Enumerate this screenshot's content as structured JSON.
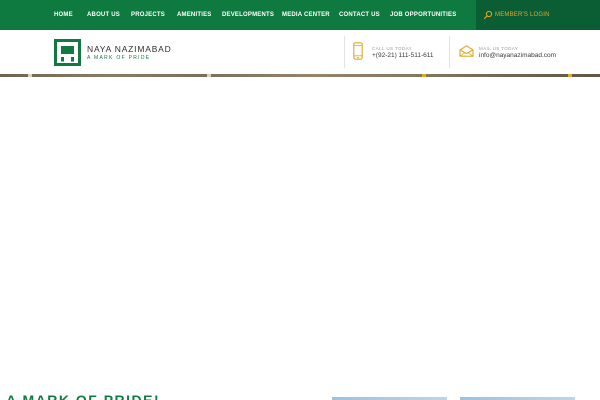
{
  "nav": {
    "items": [
      {
        "label": "HOME"
      },
      {
        "label": "ABOUT US"
      },
      {
        "label": "PROJECTS"
      },
      {
        "label": "AMENITIES"
      },
      {
        "label": "DEVELOPMENTS"
      },
      {
        "label": "MEDIA CENTER"
      },
      {
        "label": "CONTACT US"
      },
      {
        "label": "JOB OPPORTUNITIES"
      }
    ],
    "members_login": "MEMBER'S LOGIN",
    "members_icon": "search-icon"
  },
  "brand": {
    "name": "NAYA NAZIMABAD",
    "tagline": "A MARK OF PRIDE",
    "logo_icon": "logo-icon"
  },
  "contact": {
    "call": {
      "label": "CALL US TODAY",
      "value": "+(92-21) 111-511-611",
      "icon": "phone-icon"
    },
    "mail": {
      "label": "MAIL US TODAY",
      "value": "info@nayanazimabad.com",
      "icon": "mail-icon"
    }
  },
  "bottom": {
    "heading": "A MARK OF PRIDE!"
  },
  "colors": {
    "brand_green": "#0f7a3f",
    "dark_green": "#0b5e34",
    "accent_gold": "#e0a82a"
  }
}
